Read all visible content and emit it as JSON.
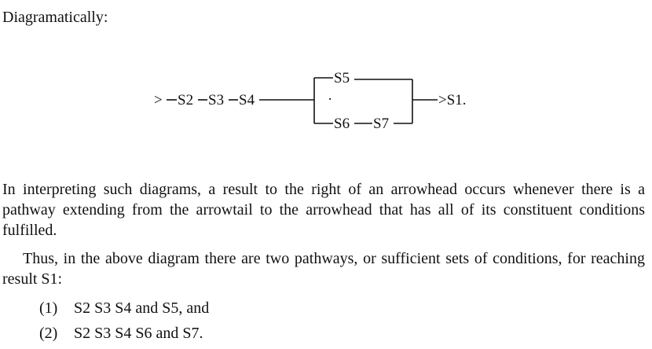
{
  "intro": "Diagramatically:",
  "diagram": {
    "start_arrow": ">",
    "nodes": [
      "S2",
      "S3",
      "S4",
      "S5",
      "S6",
      "S7"
    ],
    "result": ">S1.",
    "dot": "·"
  },
  "paragraphs": [
    "In interpreting such diagrams, a result to the right of an arrowhead occurs whenever there is a pathway extending from the arrowtail to the arrowhead that has all of its constituent conditions fulfilled.",
    "Thus, in the above diagram there are two pathways, or sufficient sets of conditions, for reaching result S1:"
  ],
  "pathways": [
    {
      "number": "(1)",
      "text": "S2 S3 S4 and S5, and"
    },
    {
      "number": "(2)",
      "text": "S2 S3 S4 S6 and S7."
    }
  ]
}
